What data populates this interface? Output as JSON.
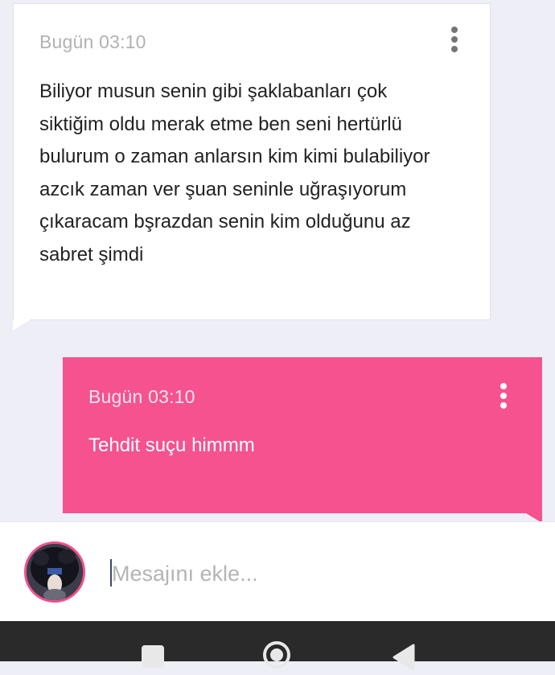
{
  "messages": [
    {
      "direction": "incoming",
      "time": "Bugün 03:10",
      "text": "Biliyor musun senin gibi şaklabanları çok\nsiktiğim oldu merak etme ben seni hertürlü\nbulurum o zaman anlarsın kim kimi bulabiliyor\nazcık zaman ver şuan seninle uğraşıyorum\nçıkaracam bşrazdan senin kim olduğunu az\nsabret şimdi",
      "menu_icon": "more-vert-icon"
    },
    {
      "direction": "outgoing",
      "time": "Bugün 03:10",
      "text": "Tehdit suçu himmm",
      "menu_icon": "more-vert-icon"
    }
  ],
  "composer": {
    "placeholder": "Mesajını ekle...",
    "value": ""
  },
  "navigation": {
    "recent_icon": "square-icon",
    "home_icon": "circle-icon",
    "back_icon": "triangle-back-icon"
  },
  "colors": {
    "background": "#eeeef7",
    "incoming_bubble": "#ffffff",
    "outgoing_bubble": "#f5528f",
    "accent": "#f0508c",
    "navbar": "#2a2a2a"
  }
}
